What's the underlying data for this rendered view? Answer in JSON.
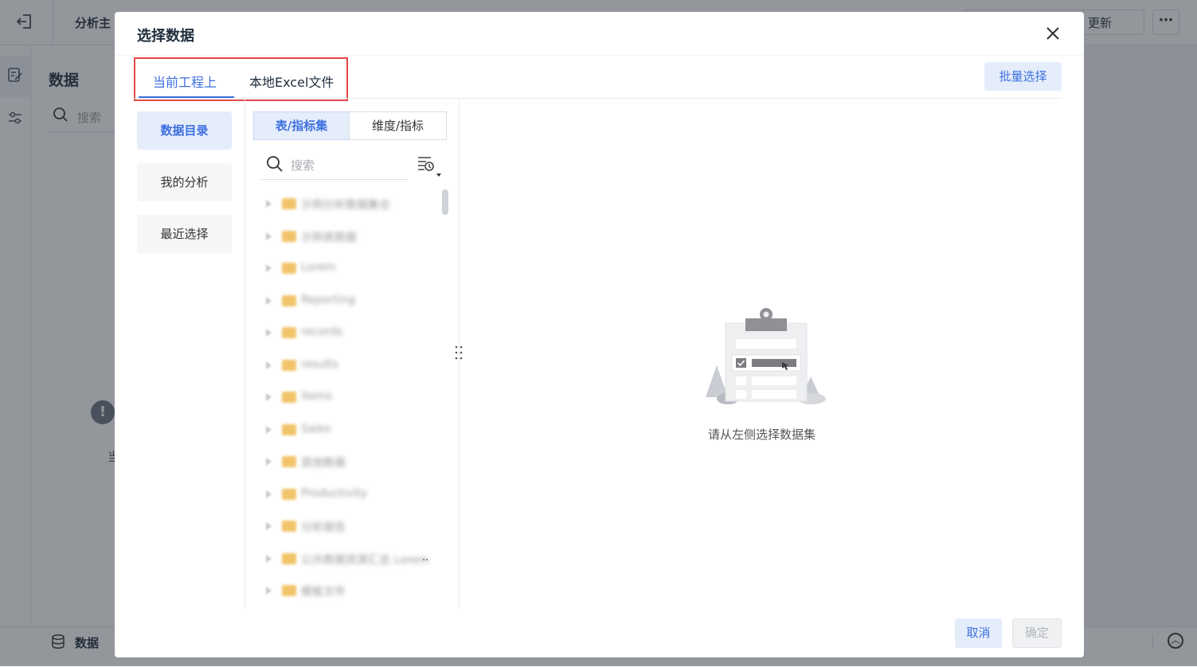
{
  "background": {
    "header_title": "分析主",
    "update_label": "更新",
    "more_label": "⋯",
    "panel_title": "数据",
    "search_placeholder": "搜索",
    "bottom_label": "数据",
    "fragment_text": "当"
  },
  "dialog": {
    "title": "选择数据",
    "tabs": [
      {
        "label": "当前工程上",
        "active": true
      },
      {
        "label": "本地Excel文件",
        "active": false
      }
    ],
    "batch_select_label": "批量选择",
    "sidebar": [
      {
        "label": "数据目录",
        "active": true
      },
      {
        "label": "我的分析",
        "active": false
      },
      {
        "label": "最近选择",
        "active": false
      }
    ],
    "segments": [
      {
        "label": "表/指标集",
        "active": true
      },
      {
        "label": "维度/指标",
        "active": false
      }
    ],
    "list_search_placeholder": "搜索",
    "tree_items": [
      {
        "label": "示例分析数据集合"
      },
      {
        "label": "示例表数据"
      },
      {
        "label": "Lorem"
      },
      {
        "label": "Reporting"
      },
      {
        "label": "records"
      },
      {
        "label": "results"
      },
      {
        "label": "items"
      },
      {
        "label": "Sales"
      },
      {
        "label": "其他数据"
      },
      {
        "label": "Productivity"
      },
      {
        "label": "分析报告"
      },
      {
        "label": "公共数据资源汇总 Lorem"
      },
      {
        "label": "模板文件"
      }
    ],
    "tree_item_ellipsis": "..",
    "empty_text": "请从左侧选择数据集",
    "cancel_label": "取消",
    "ok_label": "确定"
  },
  "colors": {
    "accent": "#3d6fe0",
    "highlight_border": "#e44848",
    "active_bg": "#e5edfb"
  }
}
